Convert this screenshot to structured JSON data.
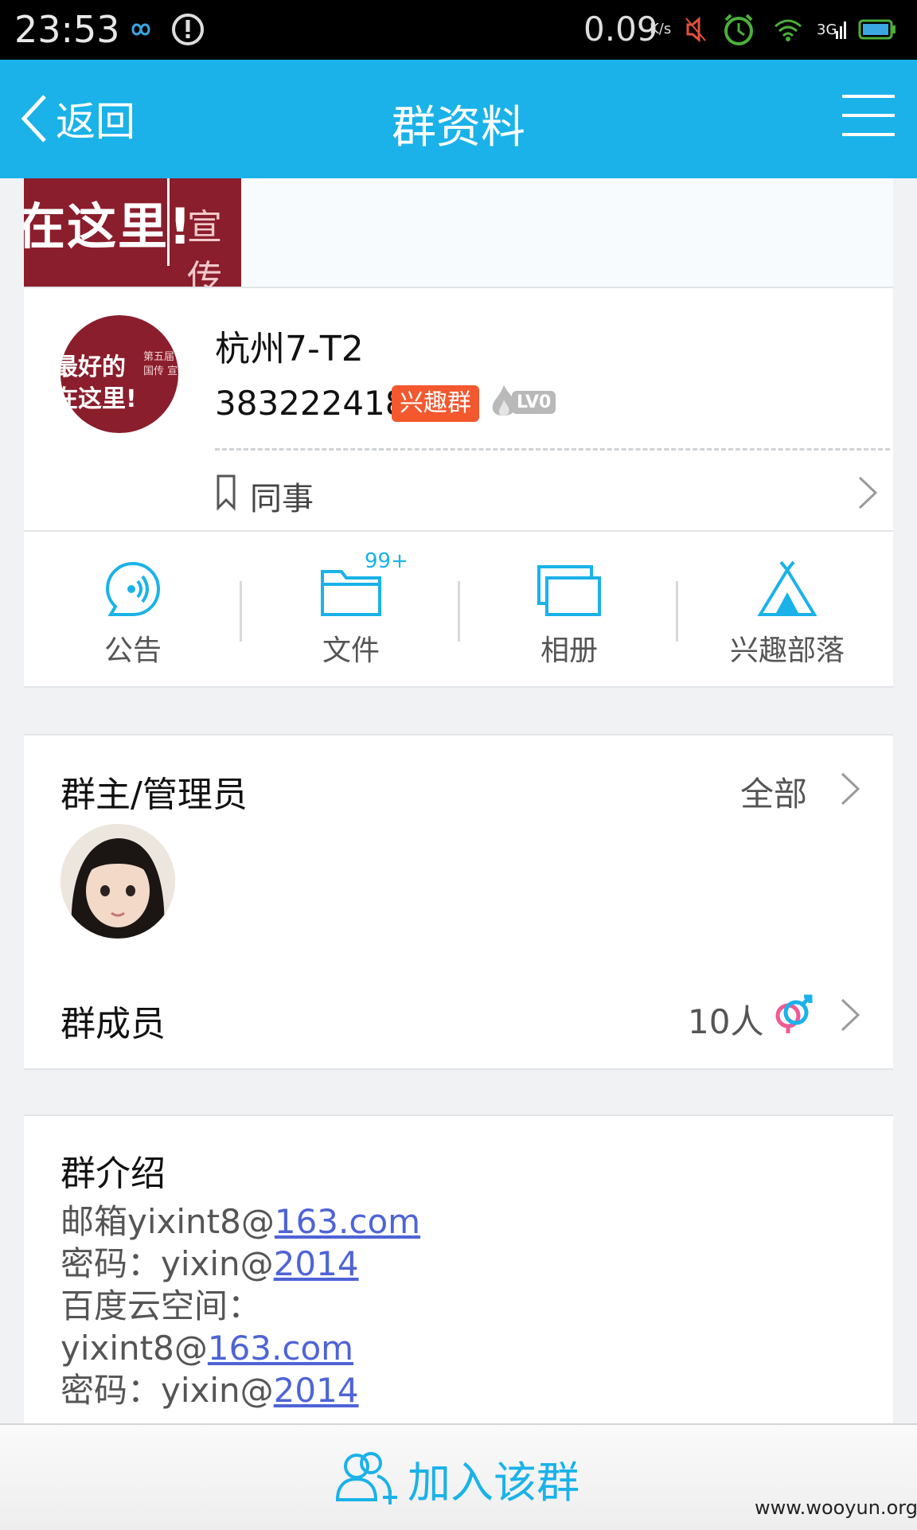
{
  "status_bar": {
    "time": "23:53",
    "net_speed": "0.09",
    "net_speed_unit": "K/s",
    "icons": [
      "infinity-icon",
      "alert-icon",
      "mute-icon",
      "alarm-icon",
      "wifi-icon",
      "signal-3g-icon",
      "battery-icon"
    ]
  },
  "nav": {
    "back_label": "返回",
    "title": "群资料"
  },
  "group": {
    "name": "杭州7-T2",
    "id": "383222418",
    "type_badge": "兴趣群",
    "level": "LV0",
    "tag": "同事",
    "banner_text": "在这里!",
    "banner_side_text": "宣传",
    "avatar_line1": "最好的",
    "avatar_line2": "在这里!",
    "avatar_side": "第五届 中国传 宣传"
  },
  "actions": [
    {
      "label": "公告",
      "icon": "announcement-icon"
    },
    {
      "label": "文件",
      "icon": "folder-icon",
      "badge": "99+"
    },
    {
      "label": "相册",
      "icon": "album-icon"
    },
    {
      "label": "兴趣部落",
      "icon": "tribe-tent-icon"
    }
  ],
  "admins": {
    "title": "群主/管理员",
    "all_label": "全部"
  },
  "members": {
    "title": "群成员",
    "count": "10人"
  },
  "intro": {
    "title": "群介绍",
    "line1_text": "邮箱yixint8@",
    "line1_link": "163.com",
    "line2_text": "密码：yixin@",
    "line2_link": "2014",
    "line3_text": "百度云空间：",
    "line4_text": "yixint8@",
    "line4_link": "163.com",
    "line5_text": "密码：yixin@",
    "line5_link": "2014"
  },
  "join": {
    "label": "加入该群"
  },
  "watermark": "www.wooyun.org",
  "colors": {
    "accent": "#1ab2e9",
    "badge": "#f3582f",
    "link": "#4e64d6",
    "banner": "#8b1e2c"
  }
}
